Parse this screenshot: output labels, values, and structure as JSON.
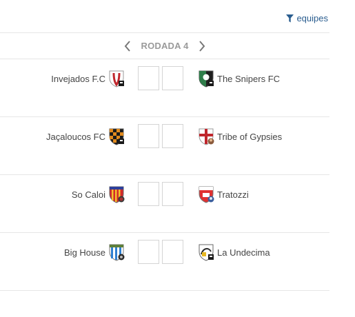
{
  "header": {
    "filter_label": "equipes",
    "filter_icon": "filter-icon",
    "accent_color": "#2a5d8f"
  },
  "round": {
    "label": "RODADA 4",
    "prev_icon": "chevron-left-icon",
    "next_icon": "chevron-right-icon"
  },
  "matches": [
    {
      "home": {
        "name": "Invejados F.C",
        "crest": "red-white-shield-icon"
      },
      "away": {
        "name": "The Snipers FC",
        "crest": "black-green-shield-icon"
      },
      "home_score": "",
      "away_score": ""
    },
    {
      "home": {
        "name": "Jaçaloucos FC",
        "crest": "black-orange-checkered-shield-icon"
      },
      "away": {
        "name": "Tribe of Gypsies",
        "crest": "white-red-cross-shield-icon"
      },
      "home_score": "",
      "away_score": ""
    },
    {
      "home": {
        "name": "So Caloi",
        "crest": "red-yellow-striped-shield-icon"
      },
      "away": {
        "name": "Tratozzi",
        "crest": "red-white-shield-icon"
      },
      "home_score": "",
      "away_score": ""
    },
    {
      "home": {
        "name": "Big House",
        "crest": "blue-white-striped-shield-icon"
      },
      "away": {
        "name": "La Undecima",
        "crest": "white-black-yellow-shield-icon"
      },
      "home_score": "",
      "away_score": ""
    }
  ]
}
